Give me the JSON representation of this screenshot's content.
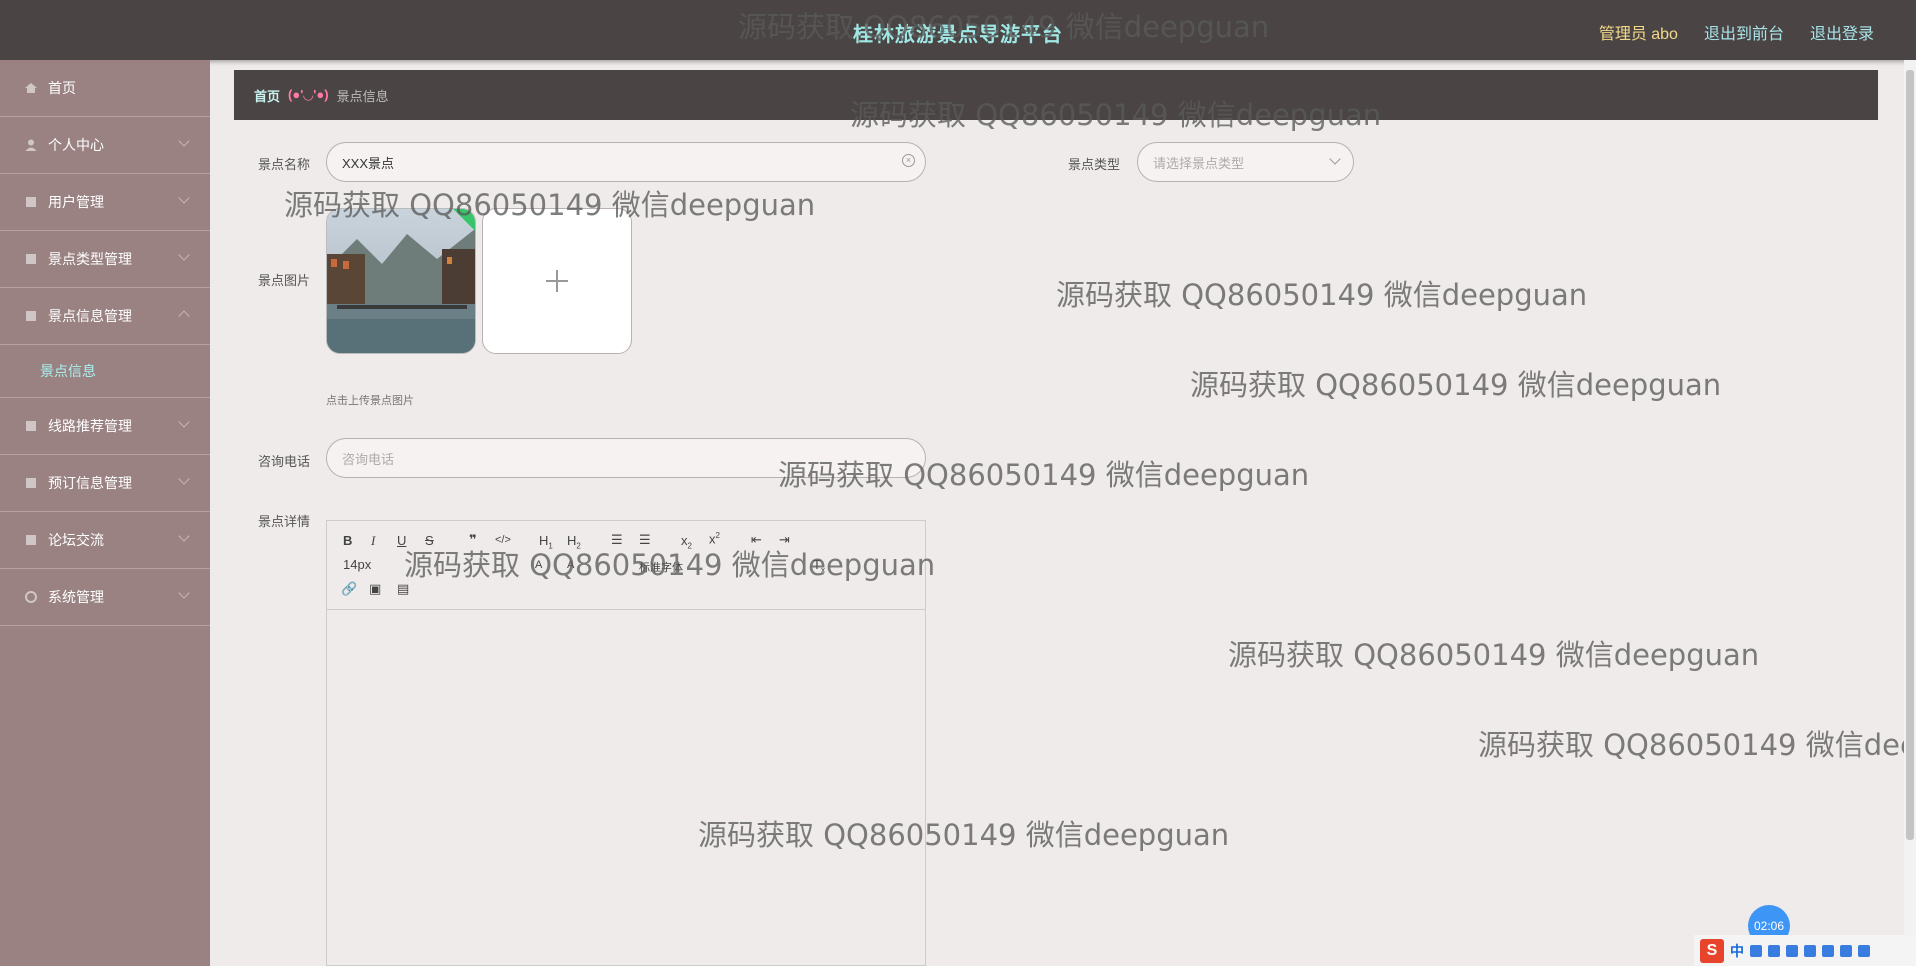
{
  "header": {
    "app_title": "桂林旅游景点导游平台",
    "admin_label": "管理员 abo",
    "back_to_front": "退出到前台",
    "logout": "退出登录"
  },
  "sidebar": {
    "items": [
      {
        "label": "首页",
        "icon": "home-icon"
      },
      {
        "label": "个人中心",
        "icon": "user-icon"
      },
      {
        "label": "用户管理",
        "icon": "users-icon"
      },
      {
        "label": "景点类型管理",
        "icon": "category-icon"
      },
      {
        "label": "景点信息管理",
        "icon": "info-icon"
      },
      {
        "label": "线路推荐管理",
        "icon": "route-icon"
      },
      {
        "label": "预订信息管理",
        "icon": "booking-icon"
      },
      {
        "label": "论坛交流",
        "icon": "forum-icon"
      },
      {
        "label": "系统管理",
        "icon": "settings-icon"
      }
    ],
    "sub_item_active": "景点信息"
  },
  "breadcrumb": {
    "home": "首页",
    "separator": "(●'◡'●)",
    "current": "景点信息"
  },
  "form": {
    "name_label": "景点名称",
    "name_value": "XXX景点",
    "type_label": "景点类型",
    "type_placeholder": "请选择景点类型",
    "image_label": "景点图片",
    "upload_hint": "点击上传景点图片",
    "phone_label": "咨询电话",
    "phone_placeholder": "咨询电话",
    "detail_label": "景点详情"
  },
  "editor": {
    "font_size": "14px",
    "font_family": "标准字体",
    "toolbar_buttons": [
      "bold",
      "italic",
      "underline",
      "strike",
      "blockquote",
      "code",
      "h1",
      "h2",
      "ordered-list",
      "bullet-list",
      "subscript",
      "superscript",
      "outdent",
      "indent",
      "link",
      "image",
      "video"
    ]
  },
  "watermark_text": "源码获取 QQ86050149 微信deepguan",
  "timer": "02:06",
  "ime": {
    "logo": "S",
    "lang": "中"
  },
  "colors": {
    "topbar": "#4a4544",
    "sidebar": "#9a8282",
    "title": "#9fe8e5",
    "admin": "#f2d98a",
    "active_sub": "#a8f0ee",
    "bc_separator": "#ff7aa8"
  }
}
